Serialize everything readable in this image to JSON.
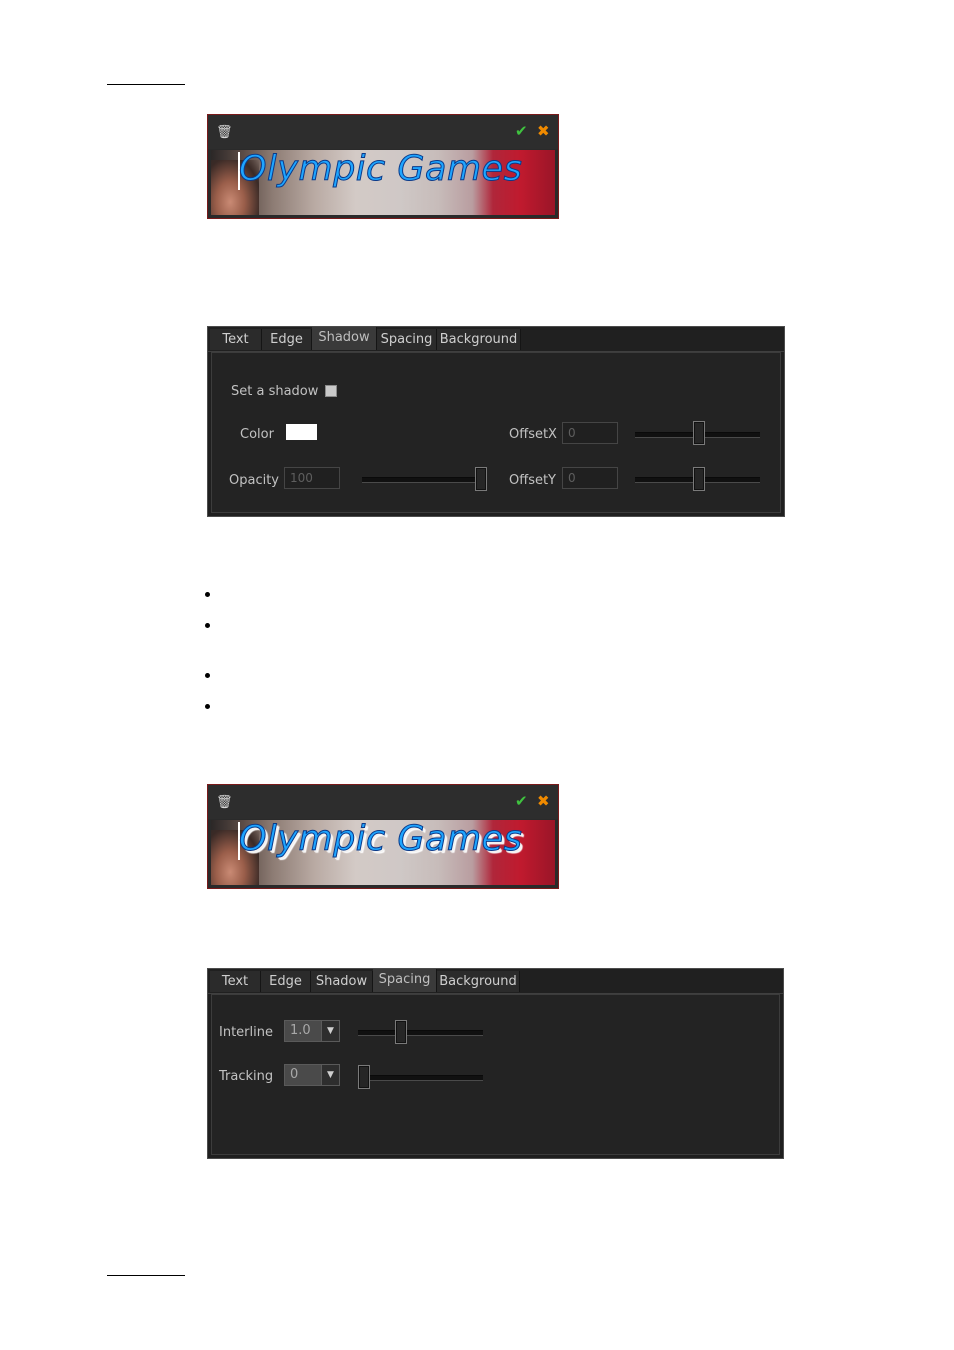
{
  "editor": {
    "title_text": "Olympic Games",
    "trash_glyph": "🗑",
    "confirm_glyph": "✔",
    "cancel_glyph": "✖"
  },
  "shadow_panel": {
    "tabs": [
      "Text",
      "Edge",
      "Shadow",
      "Spacing",
      "Background"
    ],
    "active_tab": "Shadow",
    "set_shadow_label": "Set a shadow",
    "color_label": "Color",
    "color_value": "#ffffff",
    "opacity_label": "Opacity",
    "opacity_value": "100",
    "offsetx_label": "OffsetX",
    "offsetx_value": "0",
    "offsety_label": "OffsetY",
    "offsety_value": "0"
  },
  "spacing_panel": {
    "tabs": [
      "Text",
      "Edge",
      "Shadow",
      "Spacing",
      "Background"
    ],
    "active_tab": "Spacing",
    "interline_label": "Interline",
    "interline_value": "1.0",
    "tracking_label": "Tracking",
    "tracking_value": "0"
  },
  "colors": {
    "title_fill": "#1ea5ff",
    "confirm": "#3fc23f",
    "cancel": "#f08a00"
  }
}
